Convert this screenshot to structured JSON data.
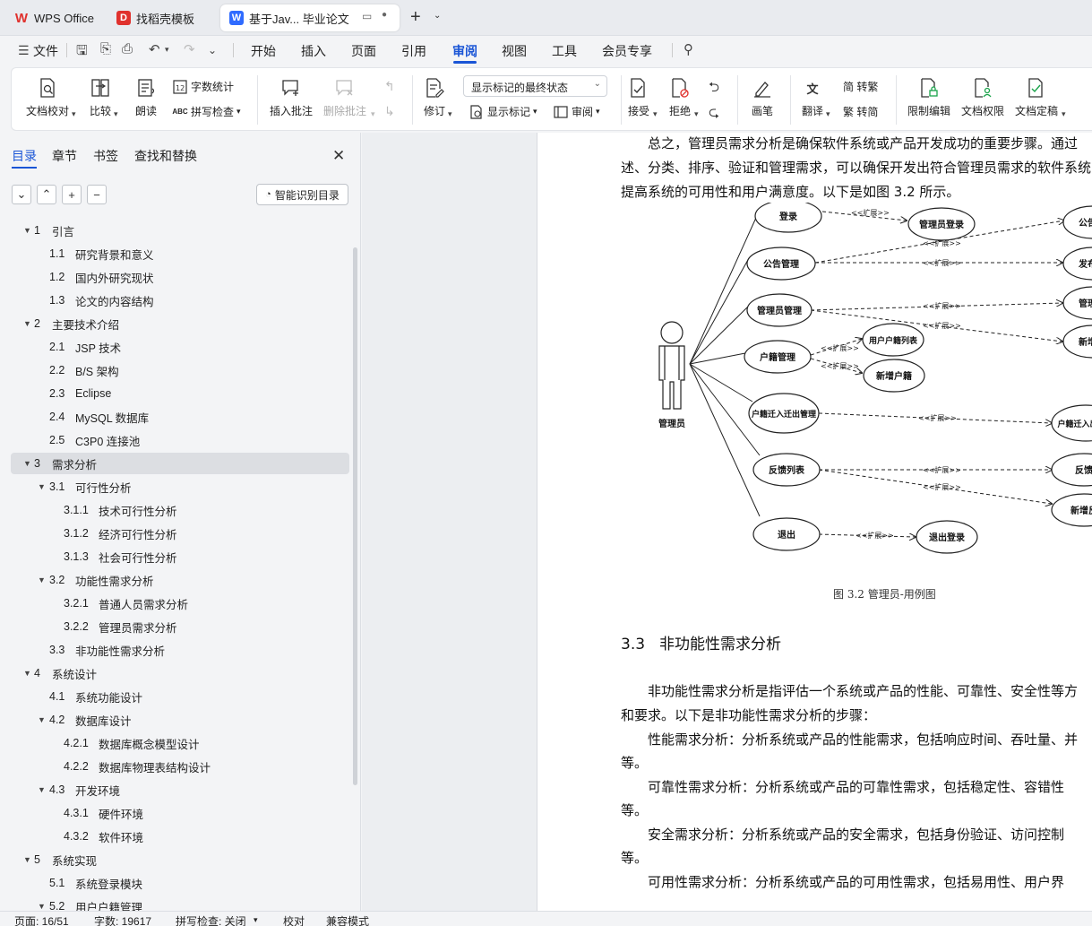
{
  "tabs": [
    {
      "label": "WPS Office"
    },
    {
      "label": "找稻壳模板"
    },
    {
      "label": "基于Jav... 毕业论文"
    }
  ],
  "menu": {
    "file": "文件",
    "items": [
      "开始",
      "插入",
      "页面",
      "引用",
      "审阅",
      "视图",
      "工具",
      "会员专享"
    ],
    "active": "审阅"
  },
  "ribbon": {
    "doc_proof": "文档校对",
    "compare": "比较",
    "read_aloud": "朗读",
    "word_count": "字数统计",
    "spell_check": "拼写检查",
    "insert_comment": "插入批注",
    "delete_comment": "删除批注",
    "track": "修订",
    "markup_state": "显示标记的最终状态",
    "show_markup": "显示标记",
    "review": "审阅",
    "accept": "接受",
    "reject": "拒绝",
    "pen": "画笔",
    "translate": "翻译",
    "to_traditional": "简 转繁",
    "to_simplified": "繁 转简",
    "restrict_edit": "限制编辑",
    "doc_permission": "文档权限",
    "doc_finalize": "文档定稿"
  },
  "panel": {
    "tabs": [
      "目录",
      "章节",
      "书签",
      "查找和替换"
    ],
    "smart_toc": "智能识别目录"
  },
  "toc": [
    {
      "num": "1",
      "label": "引言",
      "level": 1,
      "arrow": true
    },
    {
      "num": "1.1",
      "label": "研究背景和意义",
      "level": 2
    },
    {
      "num": "1.2",
      "label": "国内外研究现状",
      "level": 2
    },
    {
      "num": "1.3",
      "label": "论文的内容结构",
      "level": 2
    },
    {
      "num": "2",
      "label": "主要技术介绍",
      "level": 1,
      "arrow": true
    },
    {
      "num": "2.1",
      "label": "JSP 技术",
      "level": 2
    },
    {
      "num": "2.2",
      "label": "B/S 架构",
      "level": 2
    },
    {
      "num": "2.3",
      "label": "Eclipse",
      "level": 2
    },
    {
      "num": "2.4",
      "label": "MySQL 数据库",
      "level": 2
    },
    {
      "num": "2.5",
      "label": "C3P0 连接池",
      "level": 2
    },
    {
      "num": "3",
      "label": "需求分析",
      "level": 1,
      "arrow": true,
      "selected": true
    },
    {
      "num": "3.1",
      "label": "可行性分析",
      "level": 2,
      "arrow": true
    },
    {
      "num": "3.1.1",
      "label": "技术可行性分析",
      "level": 3
    },
    {
      "num": "3.1.2",
      "label": "经济可行性分析",
      "level": 3
    },
    {
      "num": "3.1.3",
      "label": "社会可行性分析",
      "level": 3
    },
    {
      "num": "3.2",
      "label": "功能性需求分析",
      "level": 2,
      "arrow": true
    },
    {
      "num": "3.2.1",
      "label": "普通人员需求分析",
      "level": 3
    },
    {
      "num": "3.2.2",
      "label": "管理员需求分析",
      "level": 3
    },
    {
      "num": "3.3",
      "label": "非功能性需求分析",
      "level": 2
    },
    {
      "num": "4",
      "label": "系统设计",
      "level": 1,
      "arrow": true
    },
    {
      "num": "4.1",
      "label": "系统功能设计",
      "level": 2
    },
    {
      "num": "4.2",
      "label": "数据库设计",
      "level": 2,
      "arrow": true
    },
    {
      "num": "4.2.1",
      "label": "数据库概念模型设计",
      "level": 3
    },
    {
      "num": "4.2.2",
      "label": "数据库物理表结构设计",
      "level": 3
    },
    {
      "num": "4.3",
      "label": "开发环境",
      "level": 2,
      "arrow": true
    },
    {
      "num": "4.3.1",
      "label": "硬件环境",
      "level": 3
    },
    {
      "num": "4.3.2",
      "label": "软件环境",
      "level": 3
    },
    {
      "num": "5",
      "label": "系统实现",
      "level": 1,
      "arrow": true
    },
    {
      "num": "5.1",
      "label": "系统登录模块",
      "level": 2
    },
    {
      "num": "5.2",
      "label": "用户户籍管理",
      "level": 2,
      "arrow": true
    }
  ],
  "document": {
    "para1": [
      "总之，管理员需求分析是确保软件系统或产品开发成功的重要步骤。通过",
      "述、分类、排序、验证和管理需求，可以确保开发出符合管理员需求的软件系统",
      "提高系统的可用性和用户满意度。以下是如图 3.2 所示。"
    ],
    "diagram": {
      "actor": "管理员",
      "use_cases": [
        "登录",
        "公告管理",
        "管理员管理",
        "户籍管理",
        "户籍迁入迁出管理",
        "反馈列表",
        "退出"
      ],
      "extend_label": "<<扩展>>",
      "ext_nodes": [
        "管理员登录",
        "用户户籍列表",
        "新增户籍",
        "退出登录",
        "公告",
        "发布",
        "管理",
        "新增",
        "户籍迁入出列表",
        "反馈",
        "新增反"
      ]
    },
    "figure_caption": "图 3.2  管理员-用例图",
    "heading_num": "3.3",
    "heading_text": "非功能性需求分析",
    "para2": [
      "非功能性需求分析是指评估一个系统或产品的性能、可靠性、安全性等方",
      "和要求。以下是非功能性需求分析的步骤：",
      "性能需求分析：分析系统或产品的性能需求，包括响应时间、吞吐量、并",
      "等。",
      "可靠性需求分析：分析系统或产品的可靠性需求，包括稳定性、容错性",
      "等。",
      "安全需求分析：分析系统或产品的安全需求，包括身份验证、访问控制",
      "等。",
      "可用性需求分析：分析系统或产品的可用性需求，包括易用性、用户界"
    ]
  },
  "status": {
    "page": "页面: 16/51",
    "words": "字数: 19617",
    "spell": "拼写检查: 关闭",
    "proof": "校对",
    "compat": "兼容模式"
  },
  "colors": {
    "accent": "#1a55d6",
    "wps_red": "#e0312d",
    "doc_blue": "#2f6bff"
  }
}
